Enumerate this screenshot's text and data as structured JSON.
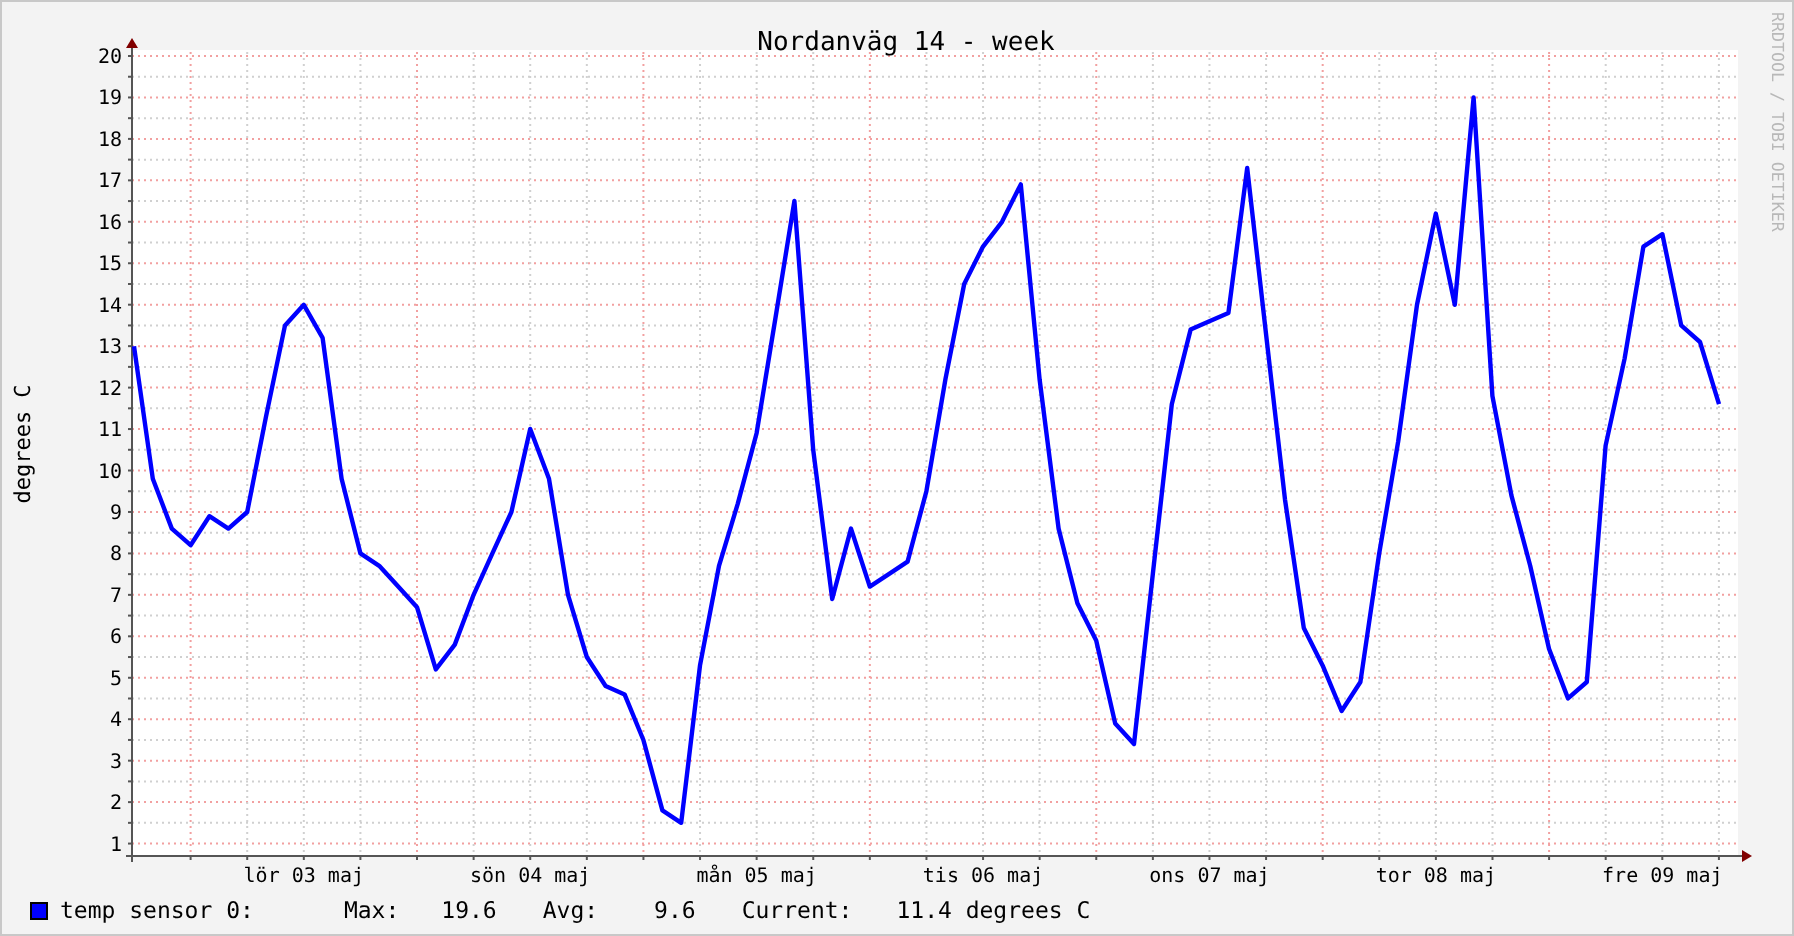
{
  "chart": {
    "credit": "RRDTOOL / TOBI OETIKER",
    "chart_data": {
      "type": "line",
      "title": "Nordanväg 14 - week",
      "ylabel": "degrees C",
      "grid": true,
      "ylim": [
        0.7,
        20
      ],
      "yticks": [
        1,
        2,
        3,
        4,
        5,
        6,
        7,
        8,
        9,
        10,
        11,
        12,
        13,
        14,
        15,
        16,
        17,
        18,
        19,
        20
      ],
      "categories": [
        null,
        null,
        null,
        null,
        null,
        null,
        null,
        null,
        null,
        "lör 03 maj",
        null,
        null,
        null,
        null,
        null,
        null,
        null,
        null,
        null,
        null,
        null,
        "sön 04 maj",
        null,
        null,
        null,
        null,
        null,
        null,
        null,
        null,
        null,
        null,
        null,
        "mån 05 maj",
        null,
        null,
        null,
        null,
        null,
        null,
        null,
        null,
        null,
        null,
        null,
        "tis 06 maj",
        null,
        null,
        null,
        null,
        null,
        null,
        null,
        null,
        null,
        null,
        null,
        "ons 07 maj",
        null,
        null,
        null,
        null,
        null,
        null,
        null,
        null,
        null,
        null,
        null,
        "tor 08 maj",
        null,
        null,
        null,
        null,
        null,
        null,
        null,
        null,
        null,
        null,
        null,
        "fre 09 maj",
        null,
        null,
        null
      ],
      "series": [
        {
          "name": "temp sensor 0:",
          "color": "#0000ff",
          "values": [
            13.0,
            9.8,
            8.6,
            8.2,
            8.9,
            8.6,
            9.0,
            11.3,
            13.5,
            14.0,
            13.2,
            9.8,
            8.0,
            7.7,
            7.2,
            6.7,
            5.2,
            5.8,
            7.0,
            8.0,
            9.0,
            11.0,
            9.8,
            7.0,
            5.5,
            4.8,
            4.6,
            3.5,
            1.8,
            1.5,
            5.3,
            7.7,
            9.2,
            10.9,
            13.7,
            16.5,
            10.5,
            6.9,
            8.6,
            7.2,
            7.5,
            7.8,
            9.5,
            12.2,
            14.5,
            15.4,
            16.0,
            16.9,
            12.2,
            8.6,
            6.8,
            5.9,
            3.9,
            3.4,
            7.5,
            11.6,
            13.4,
            13.6,
            13.8,
            17.3,
            13.3,
            9.3,
            6.2,
            5.3,
            4.2,
            4.9,
            8.0,
            10.7,
            14.0,
            16.2,
            14.0,
            19.0,
            11.8,
            9.4,
            7.7,
            5.7,
            4.5,
            4.9,
            10.6,
            12.7,
            15.4,
            15.7,
            13.5,
            13.1,
            11.6
          ]
        }
      ]
    }
  },
  "legend": {
    "max_label": "Max:",
    "max": "19.6",
    "avg_label": "Avg:",
    "avg": "9.6",
    "current_label": "Current:",
    "current": "11.4 degrees C"
  }
}
